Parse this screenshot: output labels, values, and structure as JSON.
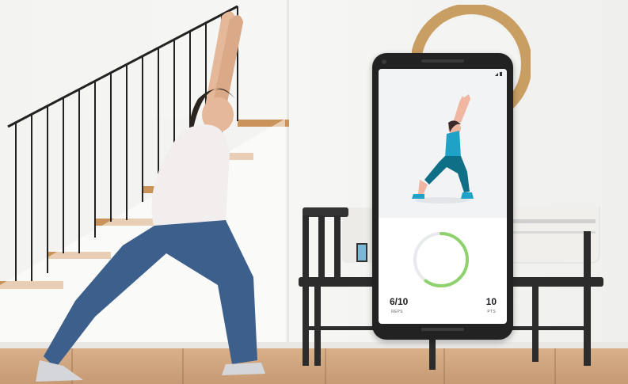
{
  "scene": {
    "description_icon": "living-room-photo"
  },
  "app": {
    "progress": {
      "reps_done": 6,
      "reps_total": 10,
      "fraction": 0.6
    },
    "reps_value": "6/10",
    "reps_label": "REPS",
    "pts_value": "10",
    "pts_label": "PTS"
  },
  "colors": {
    "progress_ring": "#8fd16c",
    "progress_track": "#e8eaed",
    "figure_shirt": "#1fa2c8",
    "figure_pants": "#0f6f87"
  }
}
